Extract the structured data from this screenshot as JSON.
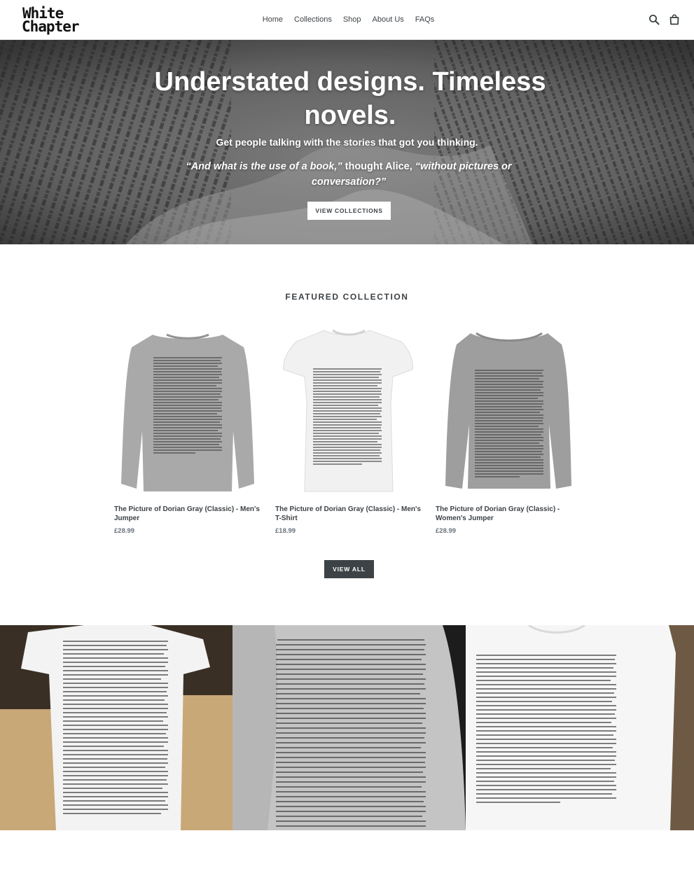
{
  "header": {
    "logo_line1": "White",
    "logo_line2": "Chapter",
    "nav": [
      "Home",
      "Collections",
      "Shop",
      "About Us",
      "FAQs"
    ],
    "search_icon": "search-icon",
    "cart_icon": "cart-icon"
  },
  "hero": {
    "title": "Understated designs. Timeless novels.",
    "subtitle": "Get people talking with the stories that got you thinking.",
    "quote_part1": "“And what is the use of a book,”",
    "quote_part2": " thought Alice, ",
    "quote_part3": "“without pictures or conversation?”",
    "button_label": "VIEW COLLECTIONS"
  },
  "featured": {
    "title": "FEATURED COLLECTION",
    "products": [
      {
        "name": "The Picture of Dorian Gray (Classic) - Men's Jumper",
        "price": "£28.99"
      },
      {
        "name": "The Picture of Dorian Gray (Classic) - Men's T-Shirt",
        "price": "£18.99"
      },
      {
        "name": "The Picture of Dorian Gray (Classic) - Women's Jumper",
        "price": "£28.99"
      }
    ],
    "view_all_label": "VIEW ALL"
  },
  "colors": {
    "text": "#3d4246",
    "button_dark": "#3d4246",
    "garment_grey": "#a7a7a7",
    "garment_white": "#f1f1f1"
  }
}
